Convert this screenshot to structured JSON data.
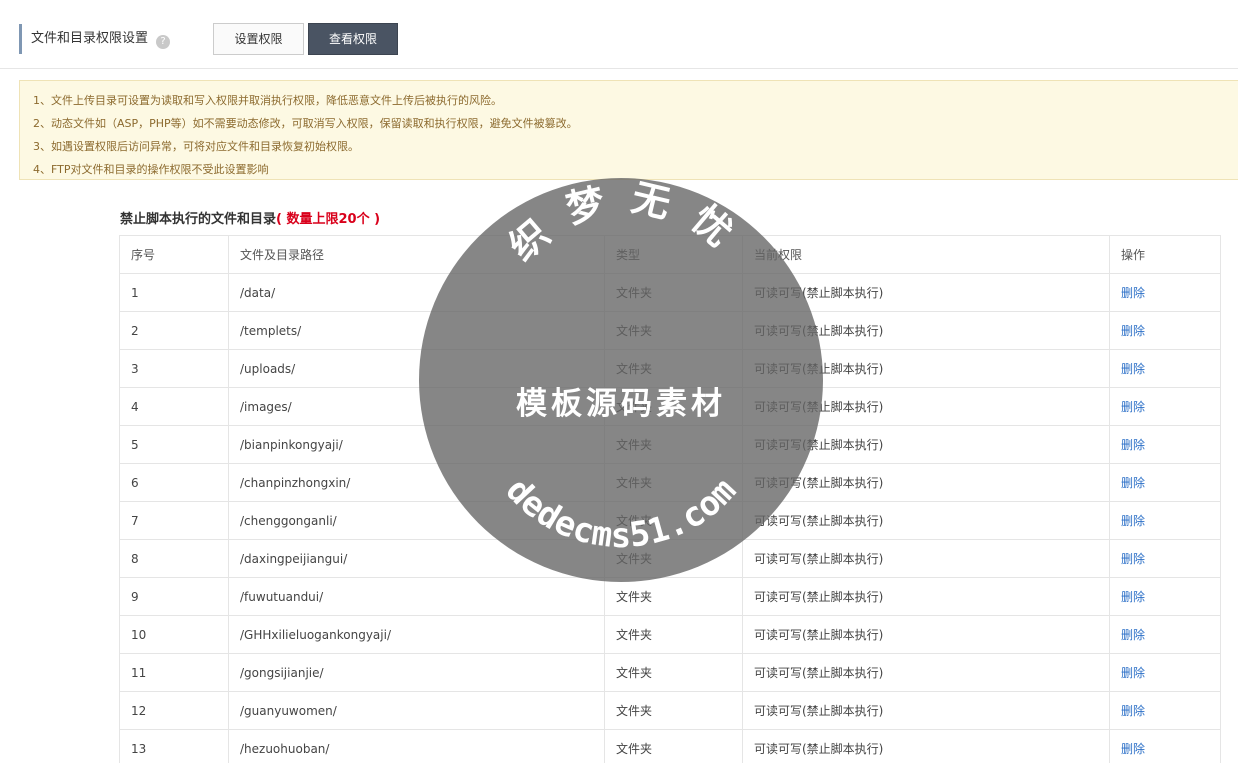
{
  "header": {
    "title": "文件和目录权限设置",
    "help": "?",
    "btn_set": "设置权限",
    "btn_view": "查看权限"
  },
  "notice": [
    "1、文件上传目录可设置为读取和写入权限并取消执行权限，降低恶意文件上传后被执行的风险。",
    "2、动态文件如（ASP，PHP等）如不需要动态修改，可取消写入权限，保留读取和执行权限，避免文件被篡改。",
    "3、如遇设置权限后访问异常，可将对应文件和目录恢复初始权限。",
    "4、FTP对文件和目录的操作权限不受此设置影响"
  ],
  "section": {
    "title": "禁止脚本执行的文件和目录",
    "limit": "( 数量上限20个 )"
  },
  "table": {
    "headers": [
      "序号",
      "文件及目录路径",
      "类型",
      "当前权限",
      "操作"
    ],
    "rows": [
      [
        "1",
        "/data/",
        "文件夹",
        "可读可写(禁止脚本执行)",
        "删除"
      ],
      [
        "2",
        "/templets/",
        "文件夹",
        "可读可写(禁止脚本执行)",
        "删除"
      ],
      [
        "3",
        "/uploads/",
        "文件夹",
        "可读可写(禁止脚本执行)",
        "删除"
      ],
      [
        "4",
        "/images/",
        "文件夹",
        "可读可写(禁止脚本执行)",
        "删除"
      ],
      [
        "5",
        "/bianpinkongyaji/",
        "文件夹",
        "可读可写(禁止脚本执行)",
        "删除"
      ],
      [
        "6",
        "/chanpinzhongxin/",
        "文件夹",
        "可读可写(禁止脚本执行)",
        "删除"
      ],
      [
        "7",
        "/chenggonganli/",
        "文件夹",
        "可读可写(禁止脚本执行)",
        "删除"
      ],
      [
        "8",
        "/daxingpeijiangui/",
        "文件夹",
        "可读可写(禁止脚本执行)",
        "删除"
      ],
      [
        "9",
        "/fuwutuandui/",
        "文件夹",
        "可读可写(禁止脚本执行)",
        "删除"
      ],
      [
        "10",
        "/GHHxilieluogankongyaji/",
        "文件夹",
        "可读可写(禁止脚本执行)",
        "删除"
      ],
      [
        "11",
        "/gongsijianjie/",
        "文件夹",
        "可读可写(禁止脚本执行)",
        "删除"
      ],
      [
        "12",
        "/guanyuwomen/",
        "文件夹",
        "可读可写(禁止脚本执行)",
        "删除"
      ],
      [
        "13",
        "/hezuohuoban/",
        "文件夹",
        "可读可写(禁止脚本执行)",
        "删除"
      ]
    ]
  },
  "watermark": {
    "top": "织梦无忧",
    "middle": "模板源码素材",
    "bottom": "dedecms51.com"
  }
}
